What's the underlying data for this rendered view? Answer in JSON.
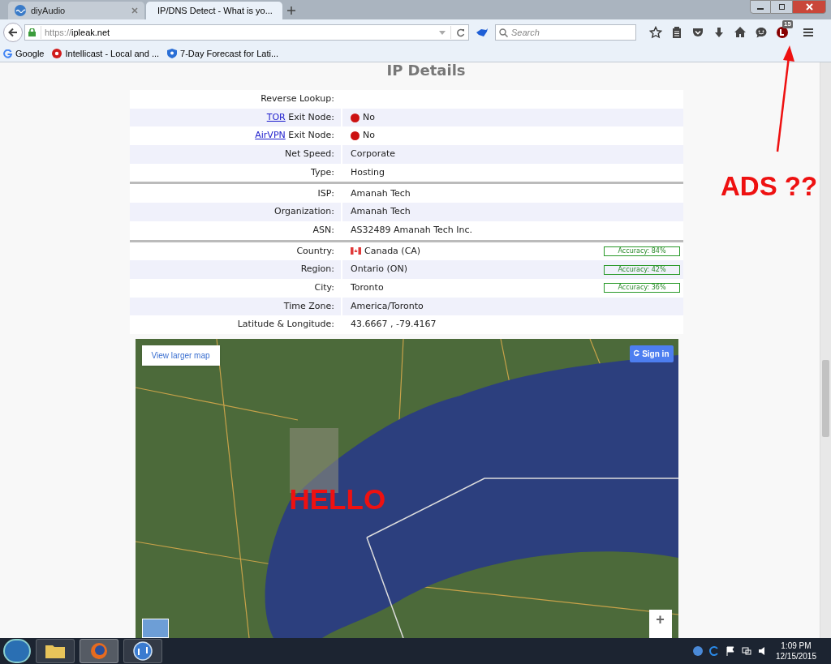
{
  "tabs": [
    {
      "title": "diyAudio",
      "selected": false
    },
    {
      "title": "IP/DNS Detect - What is yo...",
      "selected": true
    }
  ],
  "address": {
    "scheme": "https://",
    "host": "ipleak.net"
  },
  "search": {
    "placeholder": "Search"
  },
  "toolbar_badge": "15",
  "bookmarks": [
    {
      "kind": "google",
      "label": "Google"
    },
    {
      "kind": "intellicast",
      "label": "Intellicast - Local and ..."
    },
    {
      "kind": "forecast",
      "label": "7-Day Forecast for Lati..."
    }
  ],
  "heading": "IP Details",
  "rows": [
    {
      "label": "Reverse Lookup:",
      "shaded": false,
      "divider_after": false
    },
    {
      "link": "TOR",
      "label": "Exit Node:",
      "value": "No",
      "status_dot": true,
      "shaded": true,
      "divider_after": false
    },
    {
      "link": "AirVPN",
      "label": "Exit Node:",
      "value": "No",
      "status_dot": true,
      "shaded": false,
      "divider_after": false
    },
    {
      "label": "Net Speed:",
      "value": "Corporate",
      "shaded": true,
      "divider_after": false
    },
    {
      "label": "Type:",
      "value": "Hosting",
      "shaded": false,
      "divider_after": true
    },
    {
      "label": "ISP:",
      "value": "Amanah Tech",
      "shaded": false,
      "divider_after": false
    },
    {
      "label": "Organization:",
      "value": "Amanah Tech",
      "shaded": true,
      "divider_after": false
    },
    {
      "label": "ASN:",
      "value": "AS32489 Amanah Tech Inc.",
      "shaded": false,
      "divider_after": true
    },
    {
      "label": "Country:",
      "value": "Canada (CA)",
      "flag": true,
      "accuracy": "Accuracy: 84%",
      "shaded": false,
      "divider_after": false
    },
    {
      "label": "Region:",
      "value": "Ontario (ON)",
      "accuracy": "Accuracy: 42%",
      "shaded": true,
      "divider_after": false
    },
    {
      "label": "City:",
      "value": "Toronto",
      "accuracy": "Accuracy: 36%",
      "shaded": false,
      "divider_after": false
    },
    {
      "label": "Time Zone:",
      "value": "America/Toronto",
      "shaded": true,
      "divider_after": false
    },
    {
      "label": "Latitude & Longitude:",
      "value": "43.6667 , -79.4167",
      "shaded": false,
      "divider_after": false
    }
  ],
  "map": {
    "larger_link": "View larger map",
    "sign_in": "Sign in",
    "zoom_in": "+"
  },
  "annotations": {
    "map_note": "HELLO",
    "toolbar_note": "ADS ??"
  },
  "clock": {
    "time": "1:09 PM",
    "date": "12/15/2015"
  }
}
